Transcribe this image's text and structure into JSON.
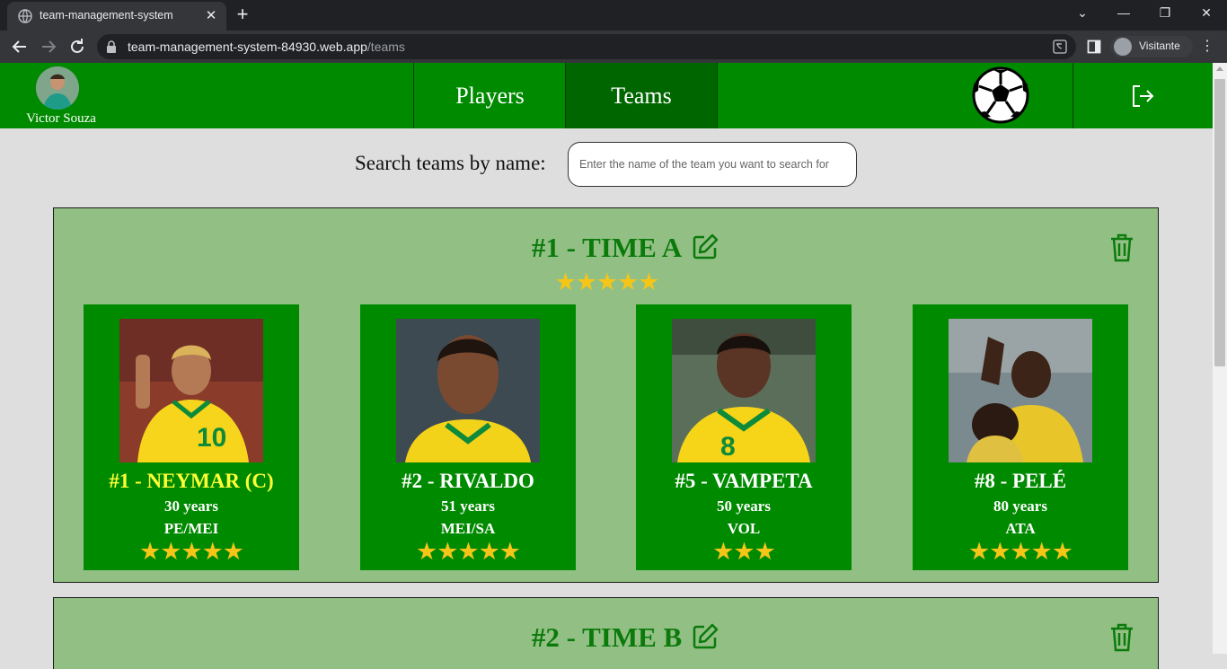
{
  "browser": {
    "tab_title": "team-management-system",
    "url_host": "team-management-system-84930.web.app",
    "url_path": "/teams",
    "profile_name": "Visitante"
  },
  "header": {
    "user_name": "Victor Souza",
    "nav": [
      {
        "label": "Players",
        "active": false
      },
      {
        "label": "Teams",
        "active": true
      }
    ],
    "logo_icon": "soccer-ball-icon",
    "logout_icon": "logout-icon"
  },
  "search": {
    "label": "Search teams by name:",
    "placeholder": "Enter the name of the team you want to search for",
    "value": ""
  },
  "teams": [
    {
      "title": "#1 - TIME A",
      "stars": "★★★★★",
      "rating": 5,
      "players": [
        {
          "name": "#1 - NEYMAR (C)",
          "age": "30 years",
          "position": "PE/MEI",
          "stars": "★★★★★",
          "rating": 5,
          "captain": true,
          "jersey_color": "#f7d51c"
        },
        {
          "name": "#2 - RIVALDO",
          "age": "51 years",
          "position": "MEI/SA",
          "stars": "★★★★★",
          "rating": 5,
          "captain": false,
          "jersey_color": "#f3d21a"
        },
        {
          "name": "#5 - VAMPETA",
          "age": "50 years",
          "position": "VOL",
          "stars": "★★★",
          "rating": 3,
          "captain": false,
          "jersey_color": "#f6d418"
        },
        {
          "name": "#8 - PELÉ",
          "age": "80 years",
          "position": "ATA",
          "stars": "★★★★★",
          "rating": 5,
          "captain": false,
          "jersey_color": "#e8c62a"
        }
      ]
    },
    {
      "title": "#2 - TIME B",
      "stars": "",
      "players": []
    }
  ],
  "colors": {
    "header_green": "#008a00",
    "active_nav": "#006700",
    "card_green": "#92c084",
    "title_green": "#0b7a0b",
    "star": "#f5c518",
    "captain_name": "#ffff35"
  }
}
